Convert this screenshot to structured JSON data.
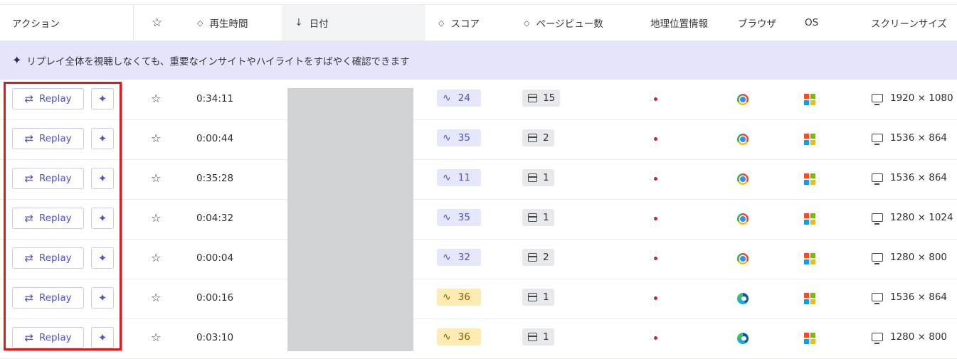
{
  "header": {
    "columns": [
      {
        "label": "アクション"
      },
      {
        "label": "",
        "icon": "star-icon"
      },
      {
        "label": "再生時間",
        "sort_icon": "sort-icon"
      },
      {
        "label": "日付",
        "sort_icon": "arrow-down-icon"
      },
      {
        "label": "スコア",
        "sort_icon": "sort-icon"
      },
      {
        "label": "ページビュー数",
        "sort_icon": "sort-icon"
      },
      {
        "label": "地理位置情報"
      },
      {
        "label": "ブラウザ"
      },
      {
        "label": "OS"
      },
      {
        "label": "スクリーンサイズ"
      }
    ]
  },
  "banner": {
    "text": "リプレイ全体を視聴しなくても、重要なインサイトやハイライトをすばやく確認できます"
  },
  "rows": [
    {
      "replay_label": "Replay",
      "duration": "0:34:11",
      "score": "24",
      "score_color": "blue",
      "pageviews": "15",
      "browser": "chrome",
      "os": "windows",
      "screen": "1920 × 1080"
    },
    {
      "replay_label": "Replay",
      "duration": "0:00:44",
      "score": "35",
      "score_color": "blue",
      "pageviews": "2",
      "browser": "chrome",
      "os": "windows",
      "screen": "1536 × 864"
    },
    {
      "replay_label": "Replay",
      "duration": "0:35:28",
      "score": "11",
      "score_color": "blue",
      "pageviews": "1",
      "browser": "chrome",
      "os": "windows",
      "screen": "1536 × 864"
    },
    {
      "replay_label": "Replay",
      "duration": "0:04:32",
      "score": "35",
      "score_color": "blue",
      "pageviews": "1",
      "browser": "chrome",
      "os": "windows",
      "screen": "1280 × 1024"
    },
    {
      "replay_label": "Replay",
      "duration": "0:00:04",
      "score": "32",
      "score_color": "blue",
      "pageviews": "2",
      "browser": "chrome",
      "os": "windows",
      "screen": "1280 × 800"
    },
    {
      "replay_label": "Replay",
      "duration": "0:00:16",
      "score": "36",
      "score_color": "yellow",
      "pageviews": "1",
      "browser": "edge",
      "os": "windows",
      "screen": "1536 × 864"
    },
    {
      "replay_label": "Replay",
      "duration": "0:03:10",
      "score": "36",
      "score_color": "yellow",
      "pageviews": "1",
      "browser": "edge",
      "os": "windows",
      "screen": "1280 × 800"
    }
  ],
  "colors": {
    "accent": "#4f52c9",
    "banner_bg": "#e4e5fb",
    "highlight": "#e5141b",
    "geo_dot": "#d6193b"
  }
}
